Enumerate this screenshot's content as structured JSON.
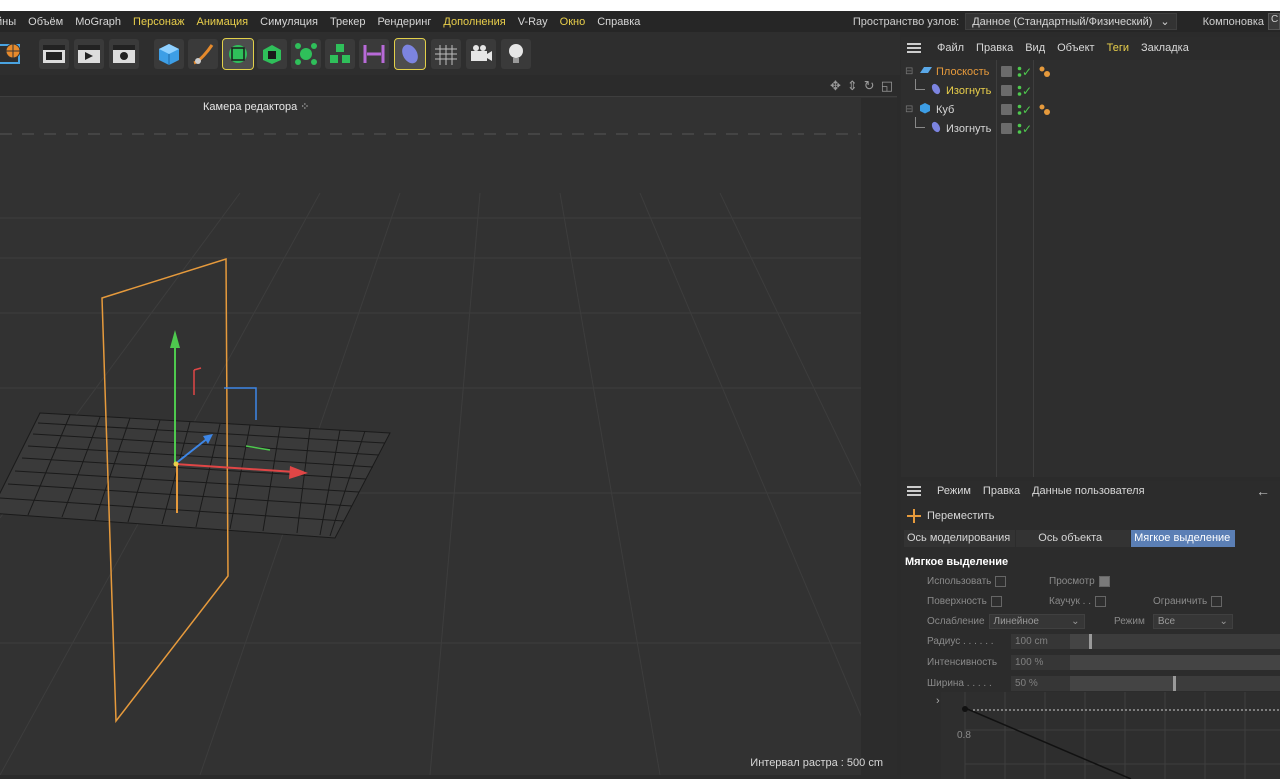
{
  "menubar": {
    "items": [
      {
        "label": "йны",
        "hl": false
      },
      {
        "label": "Объём",
        "hl": false
      },
      {
        "label": "MoGraph",
        "hl": false
      },
      {
        "label": "Персонаж",
        "hl": true
      },
      {
        "label": "Анимация",
        "hl": true
      },
      {
        "label": "Симуляция",
        "hl": false
      },
      {
        "label": "Трекер",
        "hl": false
      },
      {
        "label": "Рендеринг",
        "hl": false
      },
      {
        "label": "Дополнения",
        "hl": true
      },
      {
        "label": "V-Ray",
        "hl": false
      },
      {
        "label": "Окно",
        "hl": true
      },
      {
        "label": "Справка",
        "hl": false
      }
    ],
    "node_space_label": "Пространство узлов:",
    "node_space_value": "Данное (Стандартный/Физический)",
    "layout_label": "Компоновка",
    "layout_value": "С"
  },
  "toolbar": {
    "icons": [
      "globe-icon",
      "clapboard-icon",
      "render-view-icon",
      "render-settings-icon",
      "cube-icon",
      "pen-icon",
      "subdivision-icon",
      "extrude-cube-icon",
      "cloner-icon",
      "mograph-cubes-icon",
      "symmetry-icon",
      "deformer-icon",
      "floor-icon",
      "camera-icon",
      "light-icon"
    ],
    "selected": "subdivision-icon"
  },
  "viewport": {
    "camera_label": "Камера редактора",
    "raster_label": "Интервал растра : 500 cm",
    "nav_icons": [
      "move-view-icon",
      "zoom-view-icon",
      "rotate-view-icon",
      "maximize-view-icon"
    ]
  },
  "object_manager": {
    "menu": [
      {
        "label": "Файл",
        "hl": false
      },
      {
        "label": "Правка",
        "hl": false
      },
      {
        "label": "Вид",
        "hl": false
      },
      {
        "label": "Объект",
        "hl": false
      },
      {
        "label": "Теги",
        "hl": true
      },
      {
        "label": "Закладка",
        "hl": false
      }
    ],
    "objects": [
      {
        "name": "Плоскость",
        "color": "orange",
        "level": 0,
        "icon": "plane-icon",
        "has_tag": true
      },
      {
        "name": "Изогнуть",
        "color": "yellow",
        "level": 1,
        "icon": "bend-icon",
        "has_tag": false
      },
      {
        "name": "Куб",
        "color": "normal",
        "level": 0,
        "icon": "cube-icon",
        "has_tag": true
      },
      {
        "name": "Изогнуть",
        "color": "normal",
        "level": 1,
        "icon": "bend-icon",
        "has_tag": false
      }
    ]
  },
  "attribute_manager": {
    "menu": [
      "Режим",
      "Правка",
      "Данные пользователя"
    ],
    "tool_name": "Переместить",
    "tabs": [
      {
        "label": "Ось моделирования",
        "active": false
      },
      {
        "label": "Ось объекта",
        "active": false
      },
      {
        "label": "Мягкое выделение",
        "active": true
      }
    ],
    "section_title": "Мягкое выделение",
    "fields": {
      "use_label": "Использовать",
      "preview_label": "Просмотр",
      "surface_label": "Поверхность",
      "rubber_label": "Каучук . .",
      "restrict_label": "Ограничить",
      "falloff_label": "Ослабление",
      "falloff_value": "Линейное",
      "mode_label": "Режим",
      "mode_value": "Все",
      "radius_label": "Радиус . . . . . .",
      "radius_value": "100 cm",
      "radius_fraction": 0.1,
      "strength_label": "Интенсивность",
      "strength_value": "100 %",
      "strength_fraction": 1.0,
      "width_label": "Ширина . . . . .",
      "width_value": "50 %",
      "width_fraction": 0.5,
      "curve_tick": "0.8"
    }
  }
}
